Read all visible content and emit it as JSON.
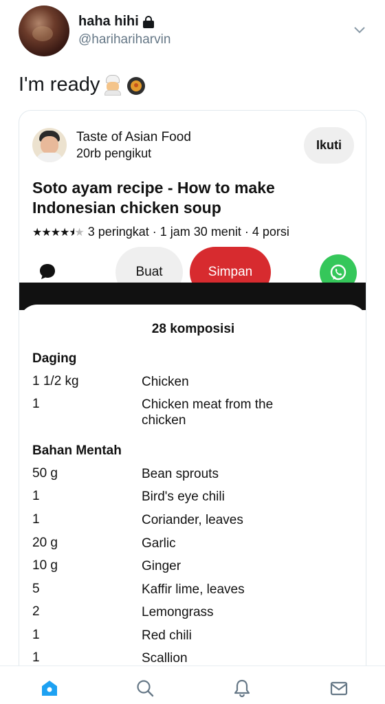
{
  "tweet": {
    "display_name": "haha hihi",
    "handle": "@harihariharvin",
    "text": "I'm ready"
  },
  "pin": {
    "channel_name": "Taste of Asian Food",
    "followers": "20rb pengikut",
    "follow_label": "Ikuti",
    "title": "Soto ayam recipe - How to make Indonesian chicken soup",
    "rating_stars": 4.5,
    "meta": "3 peringkat · 1 jam 30 menit · 4 porsi",
    "make_label": "Buat",
    "save_label": "Simpan"
  },
  "ingredients": {
    "title": "28 komposisi",
    "sections": [
      {
        "name": "Daging",
        "items": [
          {
            "qty": "1 1/2 kg",
            "name": "Chicken"
          },
          {
            "qty": "1",
            "name": "Chicken meat from the chicken"
          }
        ]
      },
      {
        "name": "Bahan Mentah",
        "items": [
          {
            "qty": "50 g",
            "name": "Bean sprouts"
          },
          {
            "qty": "1",
            "name": "Bird's eye chili"
          },
          {
            "qty": "1",
            "name": "Coriander, leaves"
          },
          {
            "qty": "20 g",
            "name": "Garlic"
          },
          {
            "qty": "10 g",
            "name": "Ginger"
          },
          {
            "qty": "5",
            "name": "Kaffir lime, leaves"
          },
          {
            "qty": "2",
            "name": "Lemongrass"
          },
          {
            "qty": "1",
            "name": "Red chili"
          },
          {
            "qty": "1",
            "name": "Scallion"
          }
        ]
      }
    ]
  },
  "colors": {
    "accent_blue": "#1da1f2",
    "save_red": "#d72b2f",
    "whatsapp_green": "#35c75a"
  },
  "icons": [
    "lock-icon",
    "chevron-down-icon",
    "chef-emoji-icon",
    "pan-food-emoji-icon",
    "comment-icon",
    "whatsapp-icon",
    "home-icon",
    "search-icon",
    "notifications-icon",
    "messages-icon"
  ]
}
